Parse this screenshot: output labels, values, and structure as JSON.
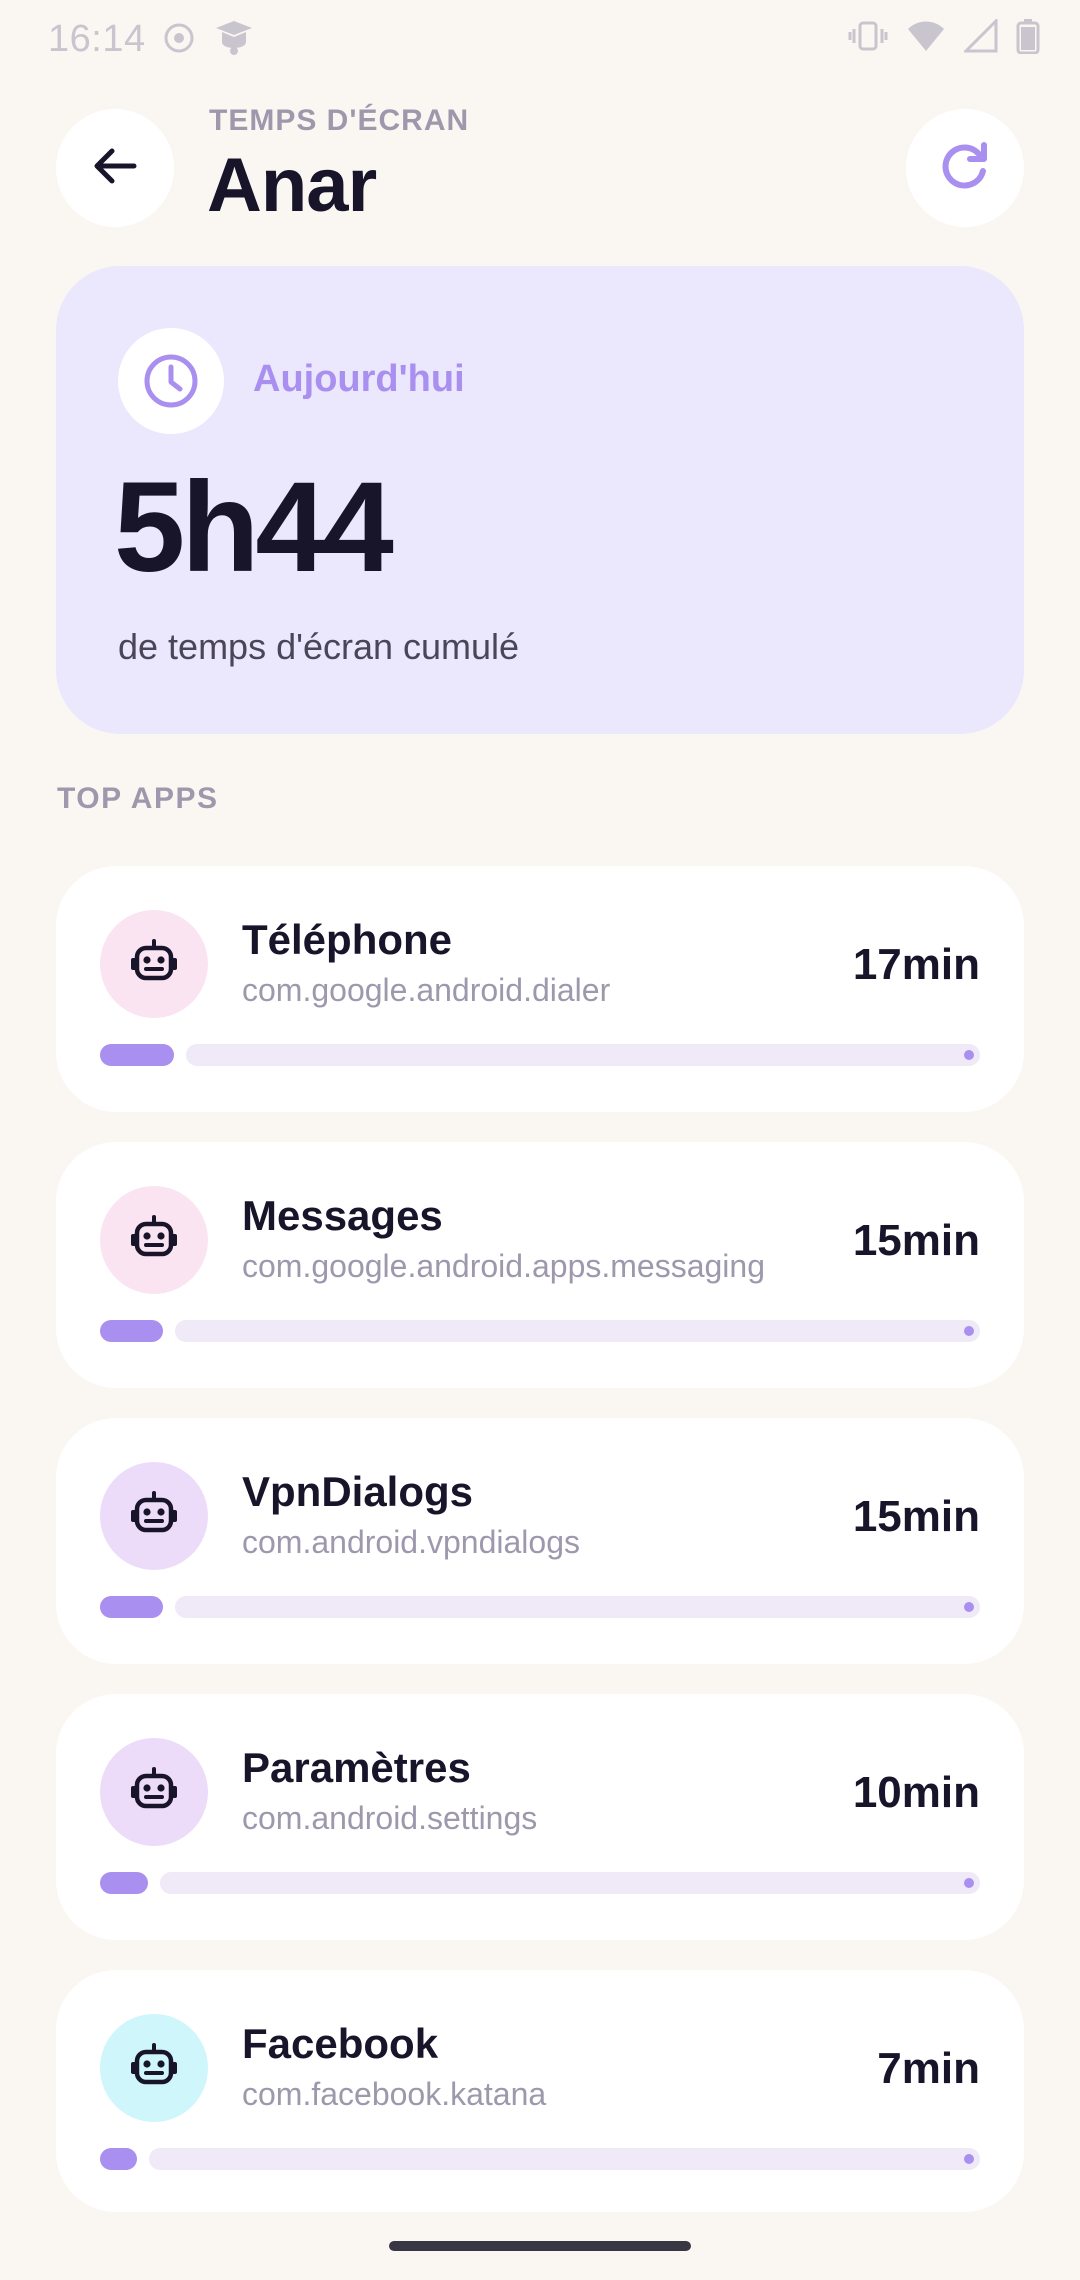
{
  "status_bar": {
    "time": "16:14",
    "left_icons": [
      "record-icon",
      "notification-app-icon"
    ],
    "right_icons": [
      "vibrate-icon",
      "wifi-icon",
      "signal-icon",
      "battery-icon"
    ]
  },
  "header": {
    "eyebrow": "TEMPS D'ÉCRAN",
    "title": "Anar",
    "back_icon": "arrow-left-icon",
    "refresh_icon": "refresh-icon"
  },
  "summary": {
    "label": "Aujourd'hui",
    "value": "5h44",
    "caption": "de temps d'écran cumulé",
    "icon": "clock-icon"
  },
  "section": {
    "label": "TOP APPS"
  },
  "apps": [
    {
      "name": "Téléphone",
      "package": "com.google.android.dialer",
      "time": "17min",
      "usage_fraction": 0.07,
      "icon_bg": "#fbe4f1"
    },
    {
      "name": "Messages",
      "package": "com.google.android.apps.messaging",
      "time": "15min",
      "usage_fraction": 0.06,
      "icon_bg": "#fbe4f1"
    },
    {
      "name": "VpnDialogs",
      "package": "com.android.vpndialogs",
      "time": "15min",
      "usage_fraction": 0.06,
      "icon_bg": "#ecdcfa"
    },
    {
      "name": "Paramètres",
      "package": "com.android.settings",
      "time": "10min",
      "usage_fraction": 0.045,
      "icon_bg": "#ecdcfa"
    },
    {
      "name": "Facebook",
      "package": "com.facebook.katana",
      "time": "7min",
      "usage_fraction": 0.035,
      "icon_bg": "#cff6fb"
    }
  ],
  "colors": {
    "accent": "#a98ff0",
    "card_summary": "#ebe7fd",
    "background": "#faf7f2"
  }
}
